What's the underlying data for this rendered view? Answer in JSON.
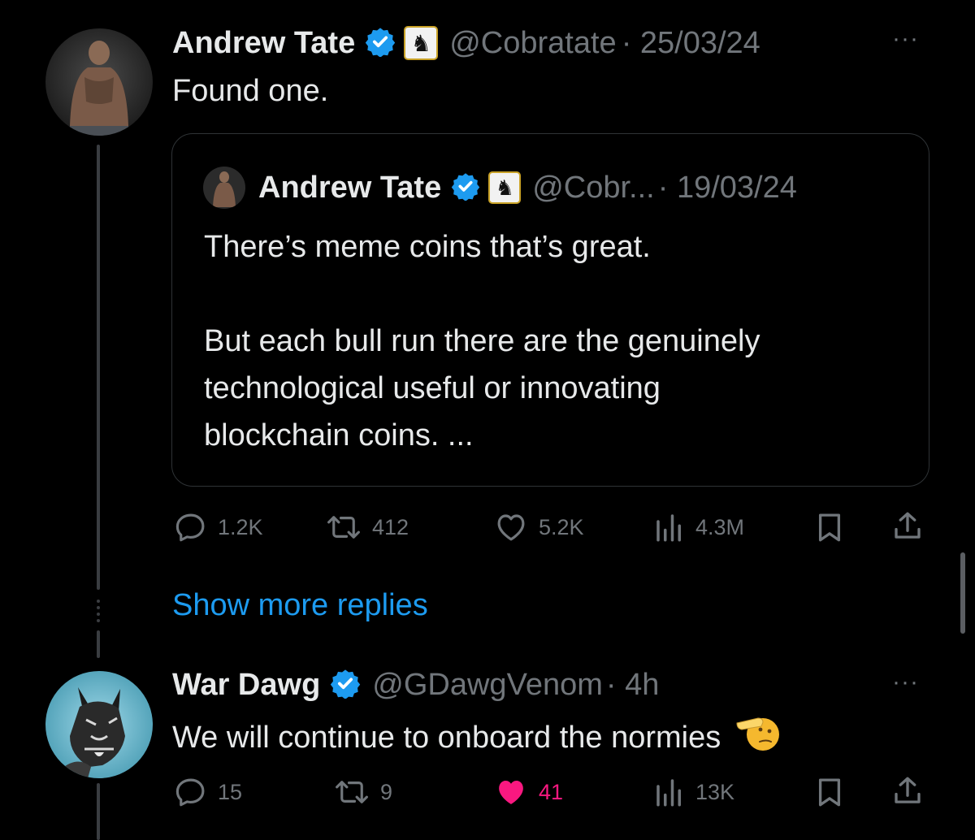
{
  "colors": {
    "background": "#000000",
    "text": "#e7e9ea",
    "muted": "#71767b",
    "link": "#1d9bf0",
    "verified": "#1d9bf0",
    "liked": "#f91880"
  },
  "tweet1": {
    "name": "Andrew Tate",
    "handle": "@Cobratate",
    "date": "· 25/03/24",
    "text": "Found one.",
    "more": "···",
    "quote": {
      "name": "Andrew Tate",
      "handle": "@Cobr...",
      "date": "· 19/03/24",
      "line1": "There’s meme coins that’s great.",
      "line2": "But each bull run there are the genuinely",
      "line3": "technological useful or innovating",
      "line4": "blockchain coins. ..."
    },
    "stats": {
      "replies": "1.2K",
      "reposts": "412",
      "likes": "5.2K",
      "views": "4.3M"
    }
  },
  "show_more": "Show more replies",
  "tweet2": {
    "name": "War Dawg",
    "handle": "@GDawgVenom",
    "date": "· 4h",
    "text": "We will continue to onboard the normies",
    "emoji": "saluting-face",
    "more": "···",
    "stats": {
      "replies": "15",
      "reposts": "9",
      "likes": "41",
      "views": "13K"
    }
  }
}
